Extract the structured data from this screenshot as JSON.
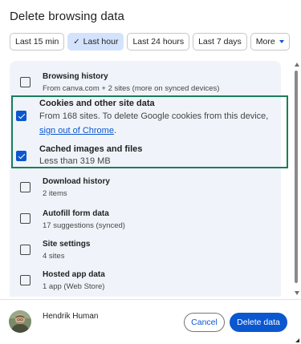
{
  "dialog": {
    "title": "Delete browsing data"
  },
  "time_ranges": {
    "options": [
      "Last 15 min",
      "Last hour",
      "Last 24 hours",
      "Last 7 days",
      "More"
    ],
    "selected": "Last hour"
  },
  "items": [
    {
      "title": "Browsing history",
      "subtitle": "From canva.com + 2 sites (more on synced devices)",
      "checked": false
    },
    {
      "title": "Cookies and other site data",
      "subtitle_prefix": "From 168 sites. To delete Google cookies from this device, ",
      "link_text": "sign out of Chrome",
      "subtitle_suffix": ".",
      "checked": true
    },
    {
      "title": "Cached images and files",
      "subtitle": "Less than 319 MB",
      "checked": true
    },
    {
      "title": "Download history",
      "subtitle": "2 items",
      "checked": false
    },
    {
      "title": "Autofill form data",
      "subtitle": "17 suggestions (synced)",
      "checked": false
    },
    {
      "title": "Site settings",
      "subtitle": "4 sites",
      "checked": false
    },
    {
      "title": "Hosted app data",
      "subtitle": "1 app (Web Store)",
      "checked": false
    }
  ],
  "account": {
    "name": "Hendrik Human"
  },
  "buttons": {
    "cancel": "Cancel",
    "delete": "Delete data"
  },
  "colors": {
    "accent": "#0b57d0",
    "selected_chip": "#d3e3fd",
    "list_background": "#f0f4fa",
    "highlight_border": "#1b7d5a"
  },
  "icons": {
    "check": "check-icon",
    "dropdown": "chevron-down-icon"
  }
}
